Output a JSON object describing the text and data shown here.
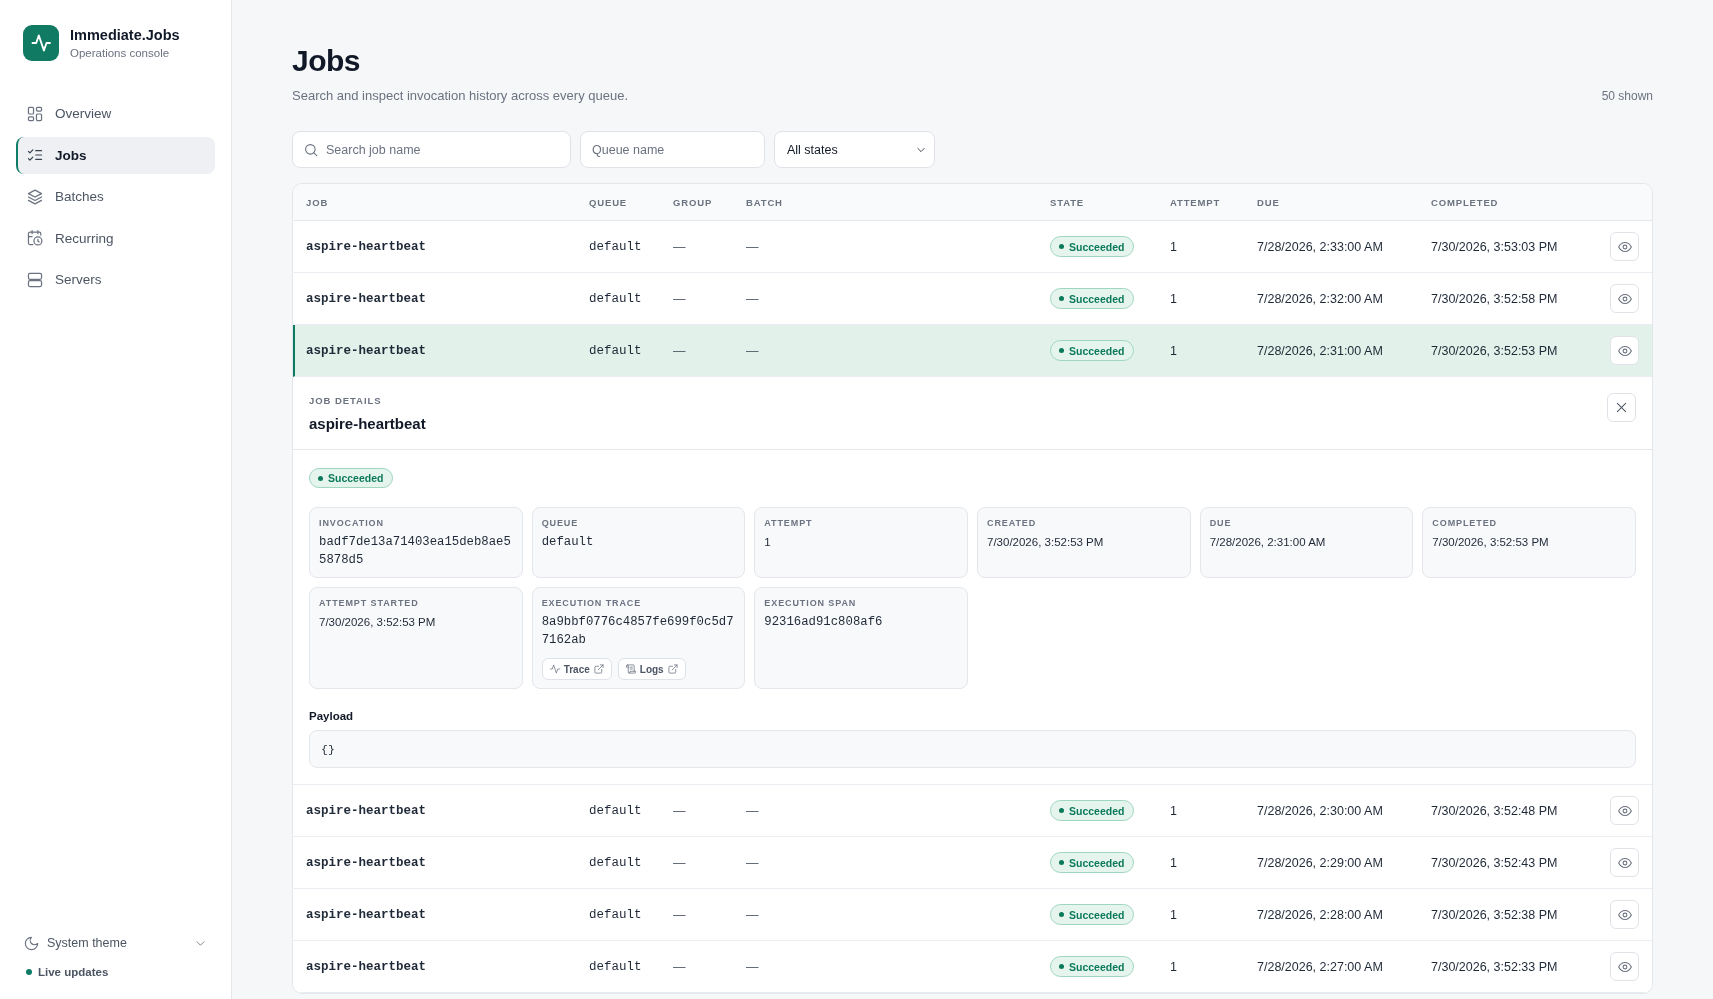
{
  "app": {
    "name": "Immediate.Jobs",
    "subtitle": "Operations console"
  },
  "sidebar": {
    "items": [
      {
        "label": "Overview",
        "selected": false
      },
      {
        "label": "Jobs",
        "selected": true
      },
      {
        "label": "Batches",
        "selected": false
      },
      {
        "label": "Recurring",
        "selected": false
      },
      {
        "label": "Servers",
        "selected": false
      }
    ],
    "theme": {
      "label": "System theme"
    },
    "live_updates": {
      "label": "Live updates",
      "on": true
    }
  },
  "page": {
    "title": "Jobs",
    "subtitle": "Search and inspect invocation history across every queue.",
    "count": "50 shown"
  },
  "filters": {
    "search": {
      "placeholder": "Search job name"
    },
    "queue": {
      "placeholder": "Queue name"
    },
    "state": {
      "value": "All states"
    }
  },
  "table": {
    "columns": [
      "JOB",
      "QUEUE",
      "GROUP",
      "BATCH",
      "STATE",
      "ATTEMPT",
      "DUE",
      "COMPLETED"
    ],
    "rows": [
      {
        "job": "aspire-heartbeat",
        "queue": "default",
        "group": "—",
        "batch": "—",
        "state": {
          "label": "Succeeded",
          "kind": "success"
        },
        "attempt": "1",
        "due": "7/28/2026, 2:33:00 AM",
        "completed": "7/30/2026, 3:53:03 PM",
        "selected": false
      },
      {
        "job": "aspire-heartbeat",
        "queue": "default",
        "group": "—",
        "batch": "—",
        "state": {
          "label": "Succeeded",
          "kind": "success"
        },
        "attempt": "1",
        "due": "7/28/2026, 2:32:00 AM",
        "completed": "7/30/2026, 3:52:58 PM",
        "selected": false
      },
      {
        "job": "aspire-heartbeat",
        "queue": "default",
        "group": "—",
        "batch": "—",
        "state": {
          "label": "Succeeded",
          "kind": "success"
        },
        "attempt": "1",
        "due": "7/28/2026, 2:31:00 AM",
        "completed": "7/30/2026, 3:52:53 PM",
        "selected": true
      },
      {
        "job": "aspire-heartbeat",
        "queue": "default",
        "group": "—",
        "batch": "—",
        "state": {
          "label": "Succeeded",
          "kind": "success"
        },
        "attempt": "1",
        "due": "7/28/2026, 2:30:00 AM",
        "completed": "7/30/2026, 3:52:48 PM",
        "selected": false
      },
      {
        "job": "aspire-heartbeat",
        "queue": "default",
        "group": "—",
        "batch": "—",
        "state": {
          "label": "Succeeded",
          "kind": "success"
        },
        "attempt": "1",
        "due": "7/28/2026, 2:29:00 AM",
        "completed": "7/30/2026, 3:52:43 PM",
        "selected": false
      },
      {
        "job": "aspire-heartbeat",
        "queue": "default",
        "group": "—",
        "batch": "—",
        "state": {
          "label": "Succeeded",
          "kind": "success"
        },
        "attempt": "1",
        "due": "7/28/2026, 2:28:00 AM",
        "completed": "7/30/2026, 3:52:38 PM",
        "selected": false
      },
      {
        "job": "aspire-heartbeat",
        "queue": "default",
        "group": "—",
        "batch": "—",
        "state": {
          "label": "Succeeded",
          "kind": "success"
        },
        "attempt": "1",
        "due": "7/28/2026, 2:27:00 AM",
        "completed": "7/30/2026, 3:52:33 PM",
        "selected": false
      }
    ],
    "details": {
      "heading": "JOB DETAILS",
      "title": "aspire-heartbeat",
      "state": {
        "label": "Succeeded",
        "kind": "success"
      },
      "fields": [
        {
          "label": "INVOCATION",
          "value": "badf7de13a71403ea15deb8ae55878d5",
          "kind": "mono"
        },
        {
          "label": "QUEUE",
          "value": "default",
          "kind": "mono"
        },
        {
          "label": "ATTEMPT",
          "value": "1",
          "kind": "text"
        },
        {
          "label": "CREATED",
          "value": "7/30/2026, 3:52:53 PM",
          "kind": "text"
        },
        {
          "label": "DUE",
          "value": "7/28/2026, 2:31:00 AM",
          "kind": "text"
        },
        {
          "label": "COMPLETED",
          "value": "7/30/2026, 3:52:53 PM",
          "kind": "text"
        },
        {
          "label": "ATTEMPT STARTED",
          "value": "7/30/2026, 3:52:53 PM",
          "kind": "text"
        },
        {
          "label": "EXECUTION TRACE",
          "value": "8a9bbf0776c4857fe699f0c5d77162ab",
          "kind": "mono",
          "links": [
            {
              "label": "Trace"
            },
            {
              "label": "Logs"
            }
          ]
        },
        {
          "label": "EXECUTION SPAN",
          "value": "92316ad91c808af6",
          "kind": "mono"
        }
      ],
      "payload": {
        "label": "Payload",
        "value": "{}"
      }
    }
  }
}
